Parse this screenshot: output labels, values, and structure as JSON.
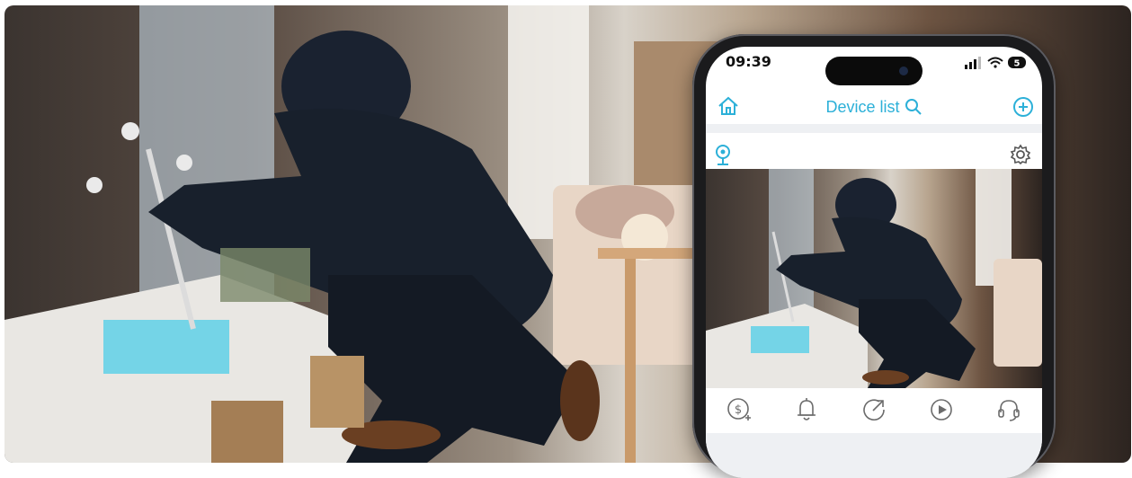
{
  "phone": {
    "status_time": "09:39",
    "battery_text": "5",
    "nav_title": "Device list"
  },
  "icons": {
    "home": "home-icon",
    "search": "search-icon",
    "add": "add-circle-icon",
    "location": "location-pin-icon",
    "settings": "gear-icon",
    "actions": [
      "dollar-plus-icon",
      "bell-icon",
      "share-icon",
      "play-icon",
      "headset-icon"
    ]
  },
  "colors": {
    "accent": "#2cb0d8",
    "icon_gray": "#6b6b6b"
  }
}
